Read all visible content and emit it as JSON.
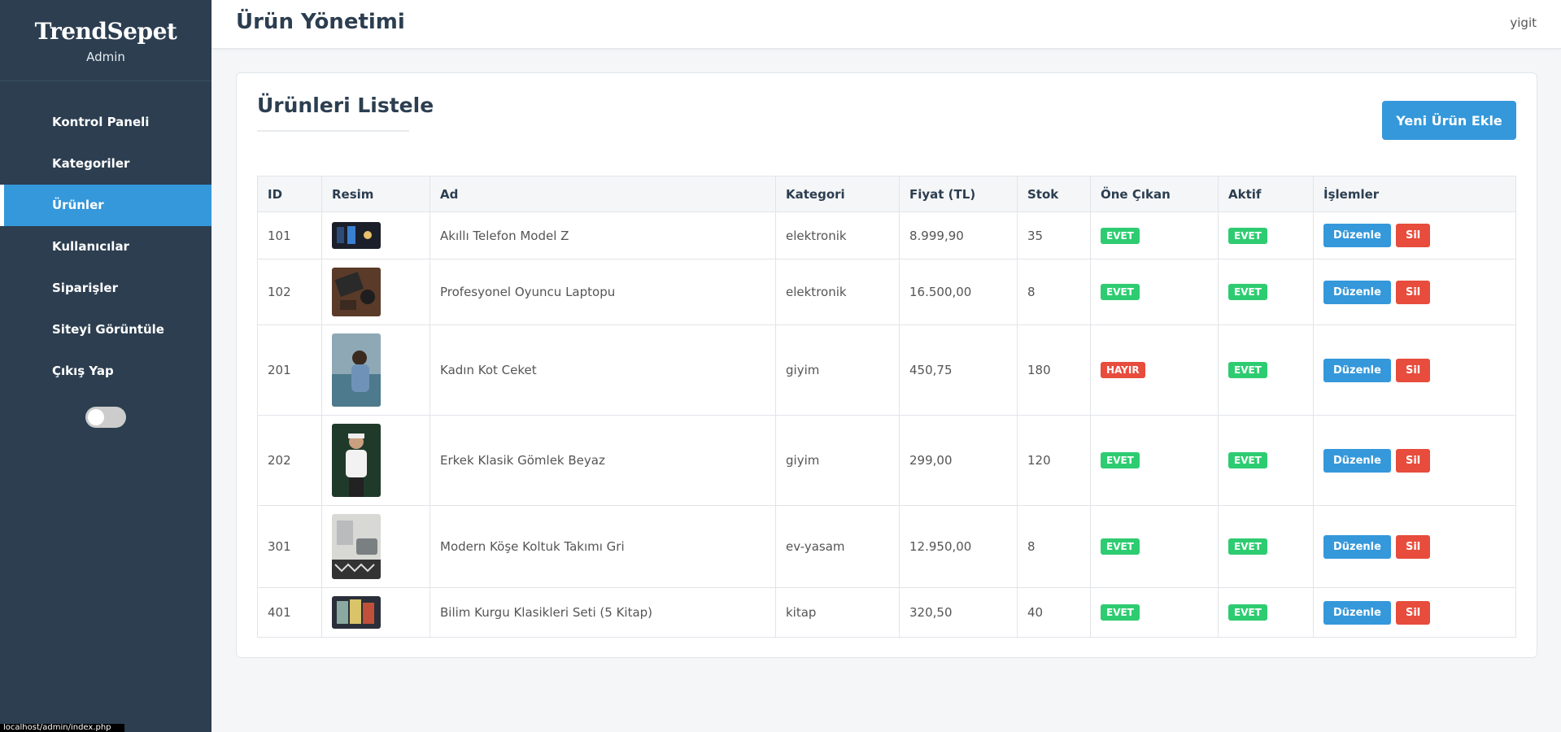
{
  "sidebar": {
    "brand": "TrendSepet",
    "subtitle": "Admin",
    "items": [
      {
        "label": "Kontrol Paneli"
      },
      {
        "label": "Kategoriler"
      },
      {
        "label": "Ürünler"
      },
      {
        "label": "Kullanıcılar"
      },
      {
        "label": "Siparişler"
      },
      {
        "label": "Siteyi Görüntüle"
      },
      {
        "label": "Çıkış Yap"
      }
    ],
    "active_item": "Ürünler",
    "theme_toggle_on": false
  },
  "header": {
    "title": "Ürün Yönetimi",
    "user": "yigit"
  },
  "main": {
    "title": "Ürünleri Listele",
    "add_button": "Yeni Ürün Ekle",
    "columns": [
      "ID",
      "Resim",
      "Ad",
      "Kategori",
      "Fiyat (TL)",
      "Stok",
      "Öne Çıkan",
      "Aktif",
      "İşlemler"
    ],
    "edit_label": "Düzenle",
    "delete_label": "Sil",
    "rows": [
      {
        "id": "101",
        "name": "Akıllı Telefon Model Z",
        "category": "elektronik",
        "price": "8.999,90",
        "stock": "35",
        "featured": "EVET",
        "active": "EVET"
      },
      {
        "id": "102",
        "name": "Profesyonel Oyuncu Laptopu",
        "category": "elektronik",
        "price": "16.500,00",
        "stock": "8",
        "featured": "EVET",
        "active": "EVET"
      },
      {
        "id": "201",
        "name": "Kadın Kot Ceket",
        "category": "giyim",
        "price": "450,75",
        "stock": "180",
        "featured": "HAYIR",
        "active": "EVET"
      },
      {
        "id": "202",
        "name": "Erkek Klasik Gömlek Beyaz",
        "category": "giyim",
        "price": "299,00",
        "stock": "120",
        "featured": "EVET",
        "active": "EVET"
      },
      {
        "id": "301",
        "name": "Modern Köşe Koltuk Takımı Gri",
        "category": "ev-yasam",
        "price": "12.950,00",
        "stock": "8",
        "featured": "EVET",
        "active": "EVET"
      },
      {
        "id": "401",
        "name": "Bilim Kurgu Klasikleri Seti (5 Kitap)",
        "category": "kitap",
        "price": "320,50",
        "stock": "40",
        "featured": "EVET",
        "active": "EVET"
      }
    ]
  },
  "status_bar": {
    "url": "localhost/admin/index.php"
  },
  "colors": {
    "sidebar_bg": "#2c3e50",
    "accent": "#3498db",
    "success": "#2ecc71",
    "danger": "#e74c3c"
  }
}
